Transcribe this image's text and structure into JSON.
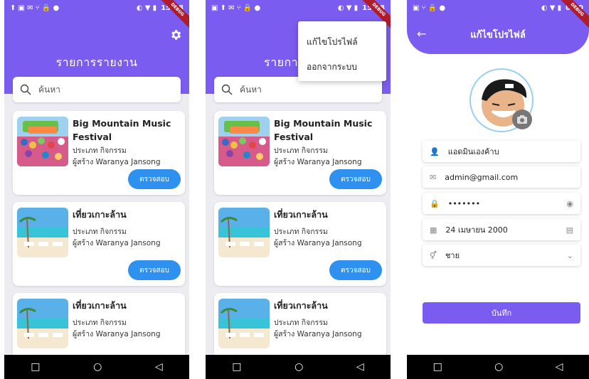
{
  "colors": {
    "primary": "#7b5cf0",
    "button": "#2e91f0",
    "navbar": "#000000"
  },
  "screen1": {
    "status_time": "15:18",
    "title": "รายการรายงาน",
    "search_placeholder": "ค้นหา",
    "cards": [
      {
        "title": "Big Mountain Music Festival",
        "type": "ประเภท กิจกรรม",
        "creator": "ผู้สร้าง Waranya Jansong",
        "button": "ตรวจสอบ"
      },
      {
        "title": "เที่ยวเกาะล้าน",
        "type": "ประเภท กิจกรรม",
        "creator": "ผู้สร้าง Waranya Jansong",
        "button": "ตรวจสอบ"
      },
      {
        "title": "เที่ยวเกาะล้าน",
        "type": "ประเภท กิจกรรม",
        "creator": "ผู้สร้าง Waranya Jansong"
      }
    ]
  },
  "screen2": {
    "status_time": "15:18",
    "title": "รายการร",
    "search_placeholder": "ค้นหา",
    "menu": [
      "แก้ไขโปรไฟล์",
      "ออกจากระบบ"
    ],
    "cards": [
      {
        "title": "Big Mountain Music Festival",
        "type": "ประเภท กิจกรรม",
        "creator": "ผู้สร้าง Waranya Jansong",
        "button": "ตรวจสอบ"
      },
      {
        "title": "เที่ยวเกาะล้าน",
        "type": "ประเภท กิจกรรม",
        "creator": "ผู้สร้าง Waranya Jansong",
        "button": "ตรวจสอบ"
      },
      {
        "title": "เที่ยวเกาะล้าน",
        "type": "ประเภท กิจกรรม",
        "creator": "ผู้สร้าง Waranya Jansong"
      }
    ]
  },
  "screen3": {
    "status_time": "04:0",
    "title": "แก้ไขโปรไฟล์",
    "fields": {
      "name": "แอดมินเองค้าบ",
      "email": "admin@gmail.com",
      "password": "•••••••",
      "birthday": "24 เมษายน 2000",
      "gender": "ชาย"
    },
    "save": "บันทึก"
  },
  "debug_label": "DEBUG",
  "nav": {
    "square": "□",
    "circle": "○",
    "back": "◁"
  }
}
